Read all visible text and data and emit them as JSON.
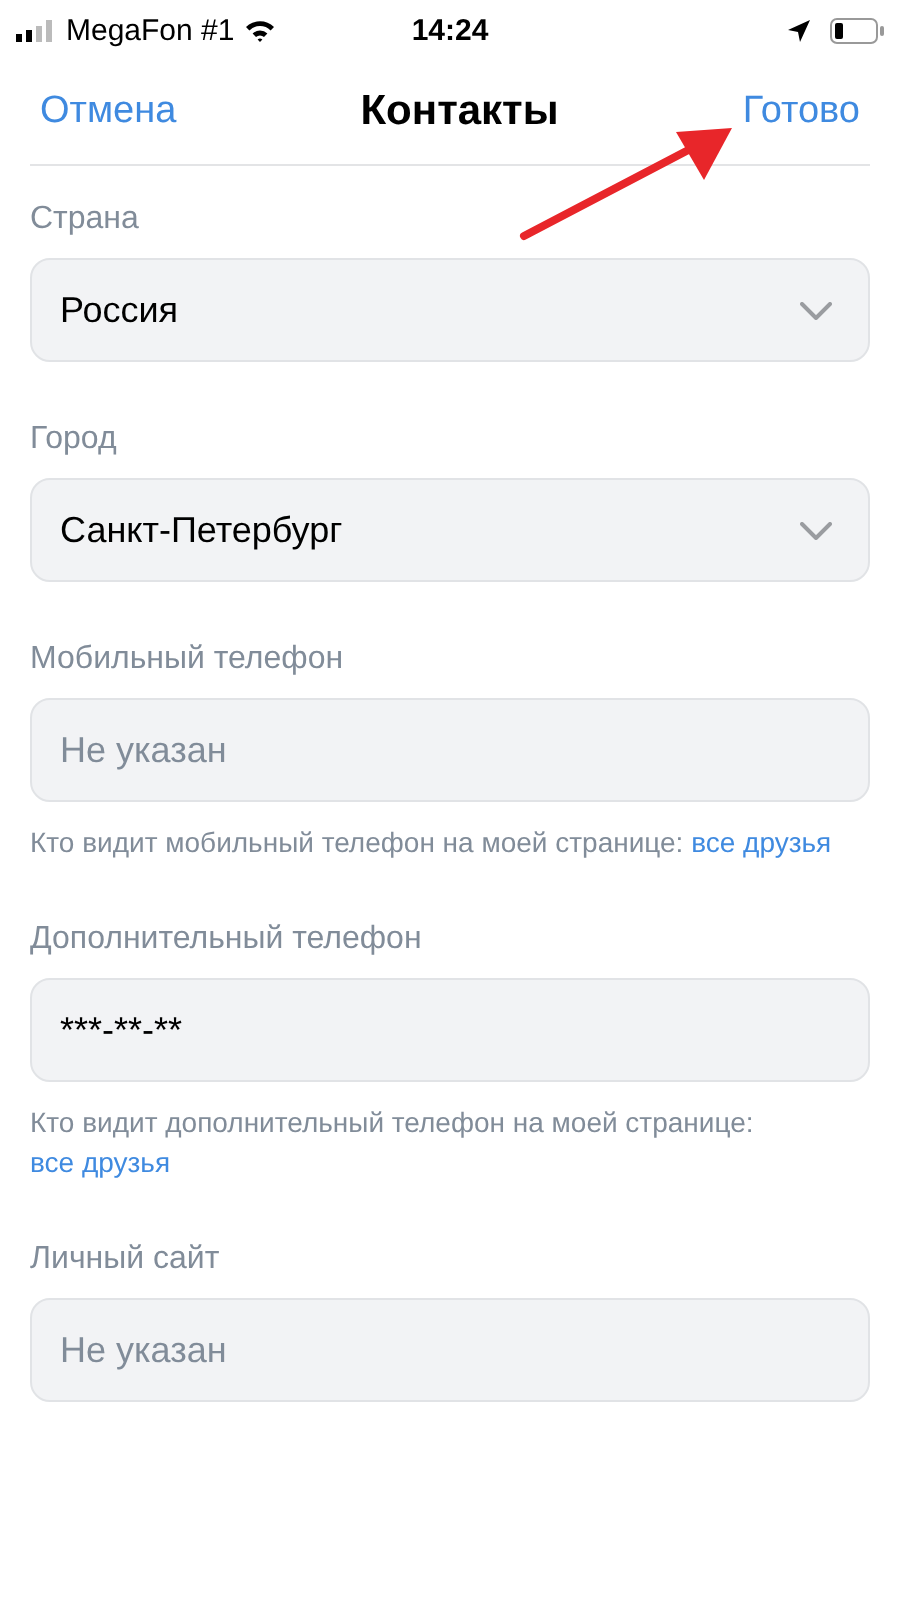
{
  "status_bar": {
    "carrier": "MegaFon #1",
    "time": "14:24"
  },
  "nav": {
    "cancel": "Отмена",
    "title": "Контакты",
    "done": "Готово"
  },
  "fields": [
    {
      "kind": "select",
      "label": "Страна",
      "value": "Россия"
    },
    {
      "kind": "select",
      "label": "Город",
      "value": "Санкт-Петербург"
    },
    {
      "kind": "input",
      "label": "Мобильный телефон",
      "placeholder": "Не указан",
      "note": {
        "text": "Кто видит мобильный телефон на моей странице:",
        "link": "все друзья"
      }
    },
    {
      "kind": "input",
      "label": "Дополнительный телефон",
      "value": "***-**-**",
      "note": {
        "text": "Кто видит дополнительный телефон на моей странице:",
        "link": "все друзья"
      }
    },
    {
      "kind": "input",
      "label": "Личный сайт",
      "placeholder": "Не указан"
    }
  ]
}
